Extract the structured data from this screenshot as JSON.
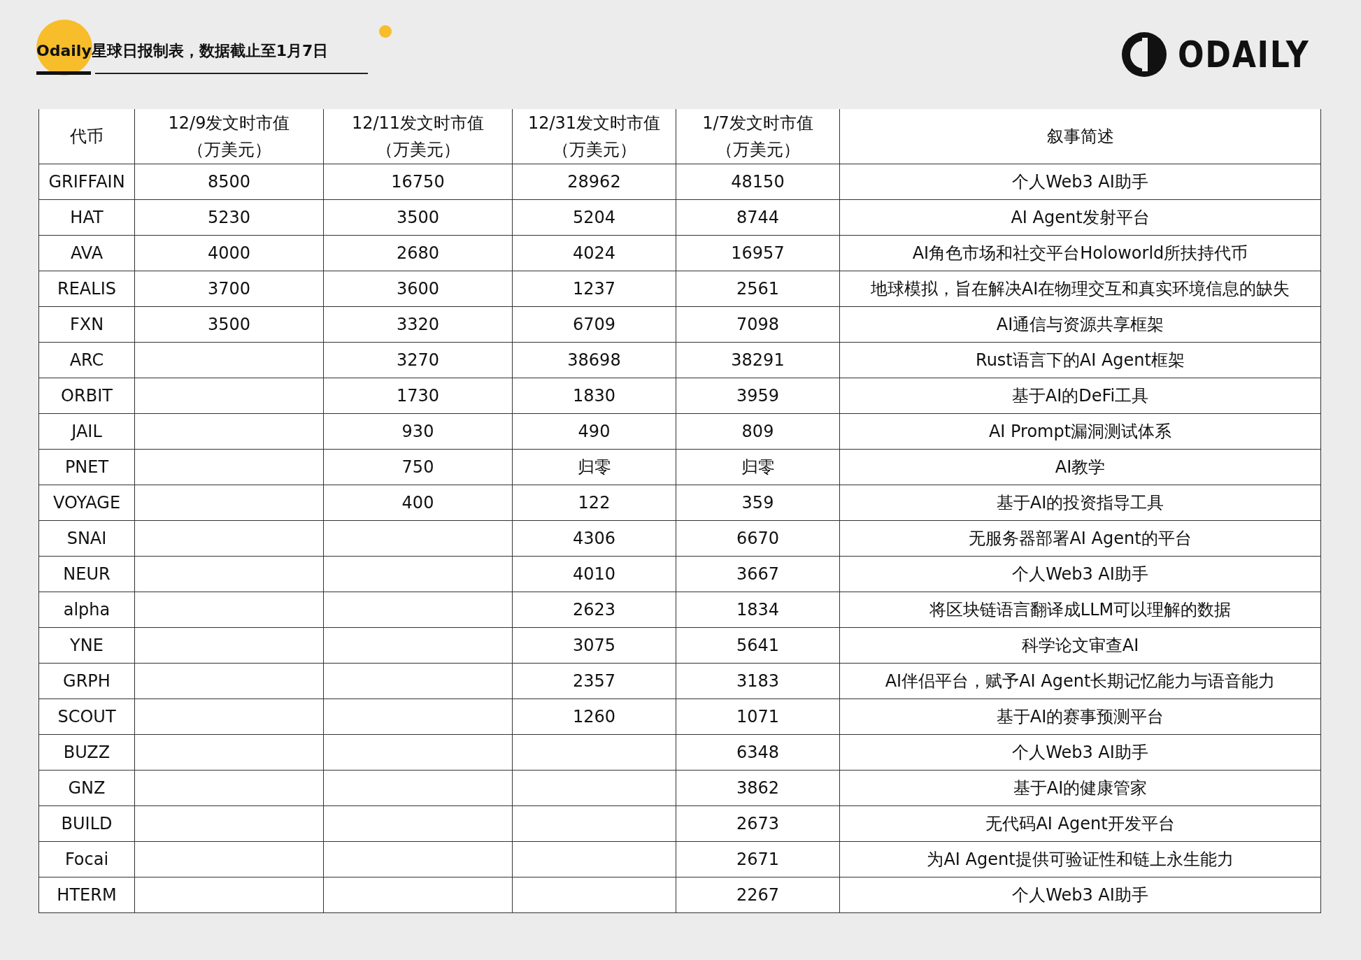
{
  "header": {
    "title": "Odaily星球日报制表，数据截止至1月7日",
    "logo": "ODAILY"
  },
  "table": {
    "columns": [
      {
        "title": "代币"
      },
      {
        "title": "12/9发文时市值",
        "unit": "（万美元）"
      },
      {
        "title": "12/11发文时市值",
        "unit": "（万美元）"
      },
      {
        "title": "12/31发文时市值",
        "unit": "（万美元）"
      },
      {
        "title": "1/7发文时市值",
        "unit": "（万美元）"
      },
      {
        "title": "叙事简述"
      }
    ],
    "rows": [
      {
        "token": "GRIFFAIN",
        "mcap_12_9": "8500",
        "mcap_12_11": "16750",
        "mcap_12_31": "28962",
        "mcap_1_7": "48150",
        "narrative": "个人Web3 AI助手"
      },
      {
        "token": "HAT",
        "mcap_12_9": "5230",
        "mcap_12_11": "3500",
        "mcap_12_31": "5204",
        "mcap_1_7": "8744",
        "narrative": "AI Agent发射平台"
      },
      {
        "token": "AVA",
        "mcap_12_9": "4000",
        "mcap_12_11": "2680",
        "mcap_12_31": "4024",
        "mcap_1_7": "16957",
        "narrative": "AI角色市场和社交平台Holoworld所扶持代币"
      },
      {
        "token": "REALIS",
        "mcap_12_9": "3700",
        "mcap_12_11": "3600",
        "mcap_12_31": "1237",
        "mcap_1_7": "2561",
        "narrative": "地球模拟，旨在解决AI在物理交互和真实环境信息的缺失"
      },
      {
        "token": "FXN",
        "mcap_12_9": "3500",
        "mcap_12_11": "3320",
        "mcap_12_31": "6709",
        "mcap_1_7": "7098",
        "narrative": "AI通信与资源共享框架"
      },
      {
        "token": "ARC",
        "mcap_12_11": "3270",
        "mcap_12_31": "38698",
        "mcap_1_7": "38291",
        "narrative": "Rust语言下的AI Agent框架"
      },
      {
        "token": "ORBIT",
        "mcap_12_11": "1730",
        "mcap_12_31": "1830",
        "mcap_1_7": "3959",
        "narrative": "基于AI的DeFi工具"
      },
      {
        "token": "JAIL",
        "mcap_12_11": "930",
        "mcap_12_31": "490",
        "mcap_1_7": "809",
        "narrative": "AI Prompt漏洞测试体系"
      },
      {
        "token": "PNET",
        "mcap_12_11": "750",
        "mcap_12_31": "归零",
        "mcap_1_7": "归零",
        "narrative": "AI教学"
      },
      {
        "token": "VOYAGE",
        "mcap_12_11": "400",
        "mcap_12_31": "122",
        "mcap_1_7": "359",
        "narrative": "基于AI的投资指导工具"
      },
      {
        "token": "SNAI",
        "mcap_12_31": "4306",
        "mcap_1_7": "6670",
        "narrative": "无服务器部署AI Agent的平台"
      },
      {
        "token": "NEUR",
        "mcap_12_31": "4010",
        "mcap_1_7": "3667",
        "narrative": "个人Web3 AI助手"
      },
      {
        "token": "alpha",
        "mcap_12_31": "2623",
        "mcap_1_7": "1834",
        "narrative": "将区块链语言翻译成LLM可以理解的数据"
      },
      {
        "token": "YNE",
        "mcap_12_31": "3075",
        "mcap_1_7": "5641",
        "narrative": "科学论文审查AI"
      },
      {
        "token": "GRPH",
        "mcap_12_31": "2357",
        "mcap_1_7": "3183",
        "narrative": "AI伴侣平台，赋予AI Agent长期记忆能力与语音能力"
      },
      {
        "token": "SCOUT",
        "mcap_12_31": "1260",
        "mcap_1_7": "1071",
        "narrative": "基于AI的赛事预测平台"
      },
      {
        "token": "BUZZ",
        "mcap_1_7": "6348",
        "narrative": "个人Web3 AI助手"
      },
      {
        "token": "GNZ",
        "mcap_1_7": "3862",
        "narrative": "基于AI的健康管家"
      },
      {
        "token": "BUILD",
        "mcap_1_7": "2673",
        "narrative": "无代码AI Agent开发平台"
      },
      {
        "token": "Focai",
        "mcap_1_7": "2671",
        "narrative": "为AI Agent提供可验证性和链上永生能力"
      },
      {
        "token": "HTERM",
        "mcap_1_7": "2267",
        "narrative": "个人Web3 AI助手"
      }
    ]
  }
}
